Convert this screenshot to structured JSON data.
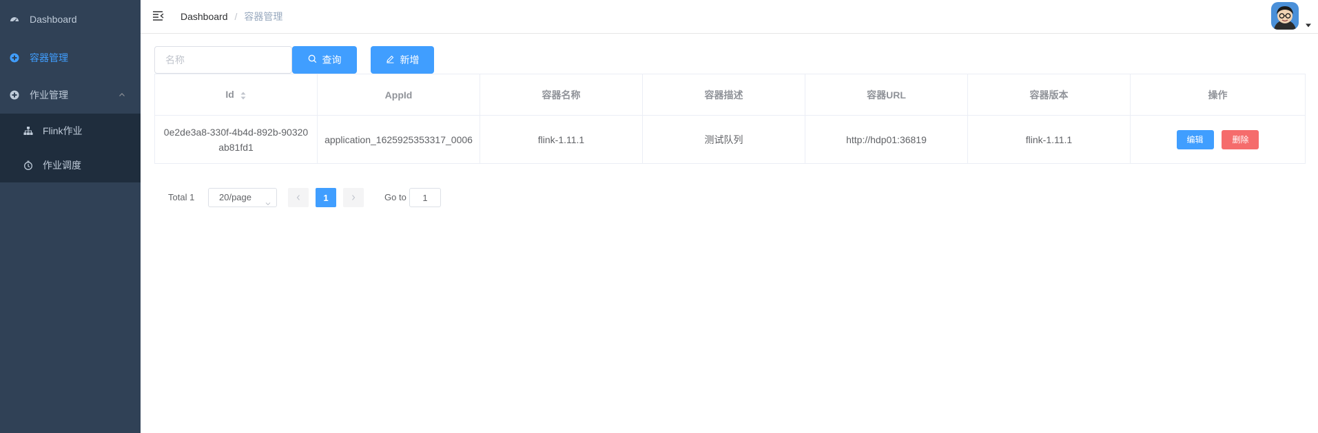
{
  "sidebar": {
    "items": [
      {
        "label": "Dashboard",
        "icon": "dashboard-icon"
      },
      {
        "label": "容器管理",
        "icon": "plus-circle-icon",
        "active": true
      },
      {
        "label": "作业管理",
        "icon": "plus-circle-icon",
        "expanded": true
      }
    ],
    "subitems": [
      {
        "label": "Flink作业",
        "icon": "tree-icon"
      },
      {
        "label": "作业调度",
        "icon": "timer-icon"
      }
    ]
  },
  "header": {
    "breadcrumb": {
      "home": "Dashboard",
      "separator": "/",
      "current": "容器管理"
    }
  },
  "toolbar": {
    "search_placeholder": "名称",
    "search_value": "",
    "search_label": "查询",
    "add_label": "新增"
  },
  "table": {
    "columns": [
      "Id",
      "AppId",
      "容器名称",
      "容器描述",
      "容器URL",
      "容器版本",
      "操作"
    ],
    "rows": [
      {
        "id": "0e2de3a8-330f-4b4d-892b-90320ab81fd1",
        "app_id": "application_1625925353317_0006",
        "name": "flink-1.11.1",
        "description": "测试队列",
        "url": "http://hdp01:36819",
        "version": "flink-1.11.1",
        "edit_label": "编辑",
        "delete_label": "删除"
      }
    ]
  },
  "pagination": {
    "total_text": "Total 1",
    "page_size": "20/page",
    "current_page": "1",
    "goto_label": "Go to",
    "goto_value": "1"
  },
  "colors": {
    "sidebar_bg": "#304156",
    "submenu_bg": "#1f2d3d",
    "primary": "#409eff",
    "danger": "#f56c6c"
  }
}
